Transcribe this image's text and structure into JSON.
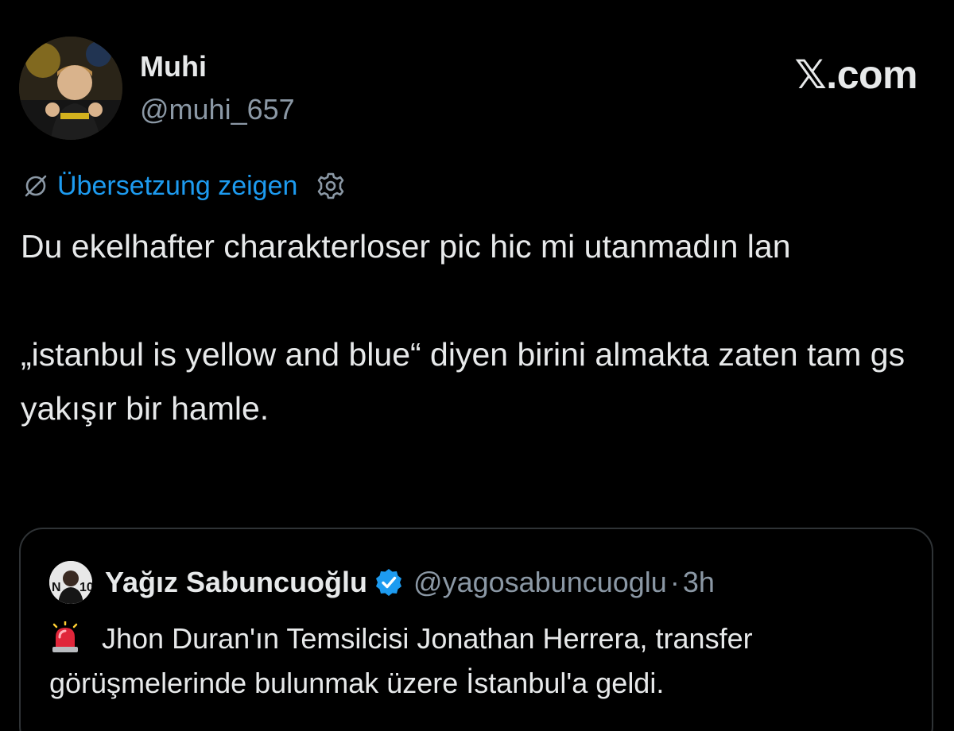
{
  "header": {
    "display_name": "Muhi",
    "handle": "@muhi_657",
    "brand": "𝕏.com",
    "avatar_icon": "profile-photo"
  },
  "translation": {
    "link_label": "Übersetzung zeigen",
    "icon": "globe-off-icon",
    "settings_icon": "gear-icon"
  },
  "tweet": {
    "paragraph_1": "Du ekelhafter charakterloser pic hic mi utanmadın lan",
    "paragraph_2": "„istanbul is yellow and blue“ diyen birini almakta zaten tam gs yakışır bir hamle."
  },
  "quote": {
    "name": "Yağız Sabuncuoğlu",
    "handle": "@yagosabuncuoglu",
    "separator": "·",
    "time": "3h",
    "text": "Jhon Duran'ın Temsilcisi Jonathan Herrera, transfer görüşmelerinde bulunmak üzere İstanbul'a geldi.",
    "verified_color": "#1d9bf0",
    "siren_icon": "siren-emoji"
  },
  "colors": {
    "background": "#000000",
    "text": "#e7e9ea",
    "muted": "#8b98a5",
    "link": "#1d9bf0",
    "border": "#2f3336"
  }
}
